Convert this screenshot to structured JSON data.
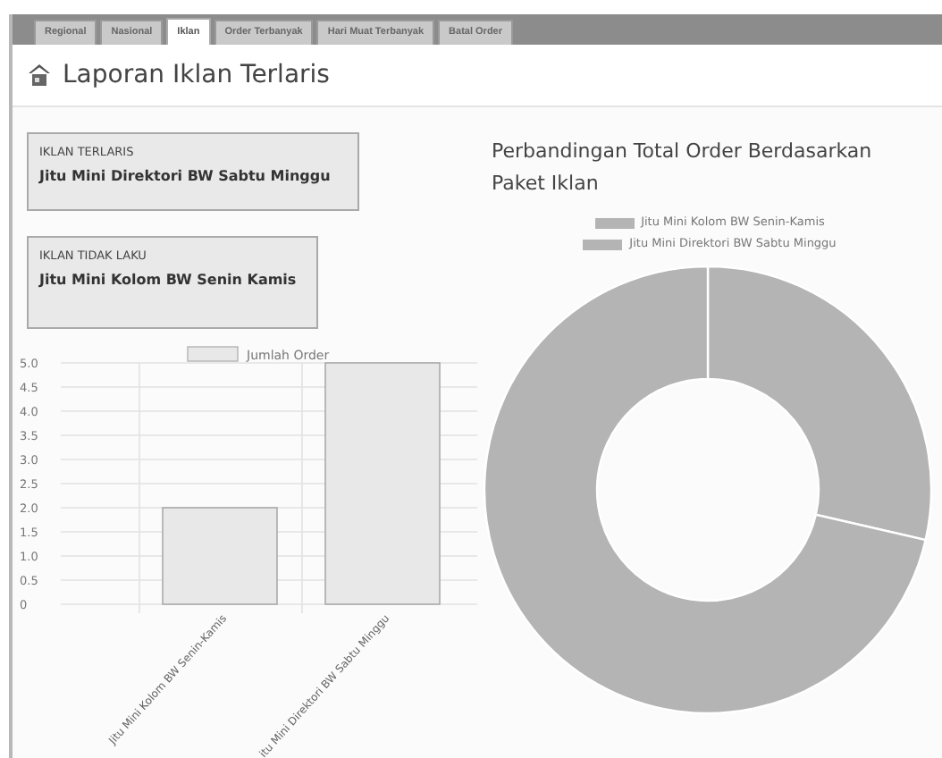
{
  "tabs": [
    {
      "label": "Regional",
      "selected": false
    },
    {
      "label": "Nasional",
      "selected": false
    },
    {
      "label": "Iklan",
      "selected": true
    },
    {
      "label": "Order Terbanyak",
      "selected": false
    },
    {
      "label": "Hari Muat Terbanyak",
      "selected": false
    },
    {
      "label": "Batal Order",
      "selected": false
    }
  ],
  "page_title": "Laporan Iklan Terlaris",
  "cards": [
    {
      "label": "IKLAN TERLARIS",
      "value": "Jitu Mini Direktori BW Sabtu Minggu"
    },
    {
      "label": "IKLAN TIDAK LAKU",
      "value": "Jitu Mini Kolom BW Senin Kamis"
    }
  ],
  "bar_chart": {
    "chart_data": {
      "type": "bar",
      "categories": [
        "Jitu Mini Kolom BW Senin-Kamis",
        "itu Mini Direktori BW Sabtu Minggu"
      ],
      "series": [
        {
          "name": "Jumlah Order",
          "color": "#e8e8e8",
          "values": [
            2,
            5
          ]
        }
      ],
      "ylim": [
        0,
        5
      ],
      "grid": true,
      "yticks": [
        {
          "value": 0,
          "label": "0"
        },
        {
          "value": 0.5,
          "label": "0.5"
        },
        {
          "value": 1,
          "label": "1.0"
        },
        {
          "value": 1.5,
          "label": "1.5"
        },
        {
          "value": 2,
          "label": "2.0"
        },
        {
          "value": 2.5,
          "label": "2.5"
        },
        {
          "value": 3,
          "label": "3.0"
        },
        {
          "value": 3.5,
          "label": "3.5"
        },
        {
          "value": 4,
          "label": "4.0"
        },
        {
          "value": 4.5,
          "label": "4.5"
        },
        {
          "value": 5,
          "label": "5.0"
        }
      ]
    }
  },
  "donut_chart": {
    "title": "Perbandingan Total Order Berdasarkan Paket Iklan",
    "chart_data": {
      "type": "donut",
      "categories": [
        "Jitu Mini Kolom BW Senin-Kamis",
        "Jitu Mini Direktori BW Sabtu Minggu"
      ],
      "values": [
        28.6,
        71.4
      ],
      "legend": "top",
      "colors": [
        "#b4b4b4",
        "#b4b4b4"
      ]
    }
  }
}
